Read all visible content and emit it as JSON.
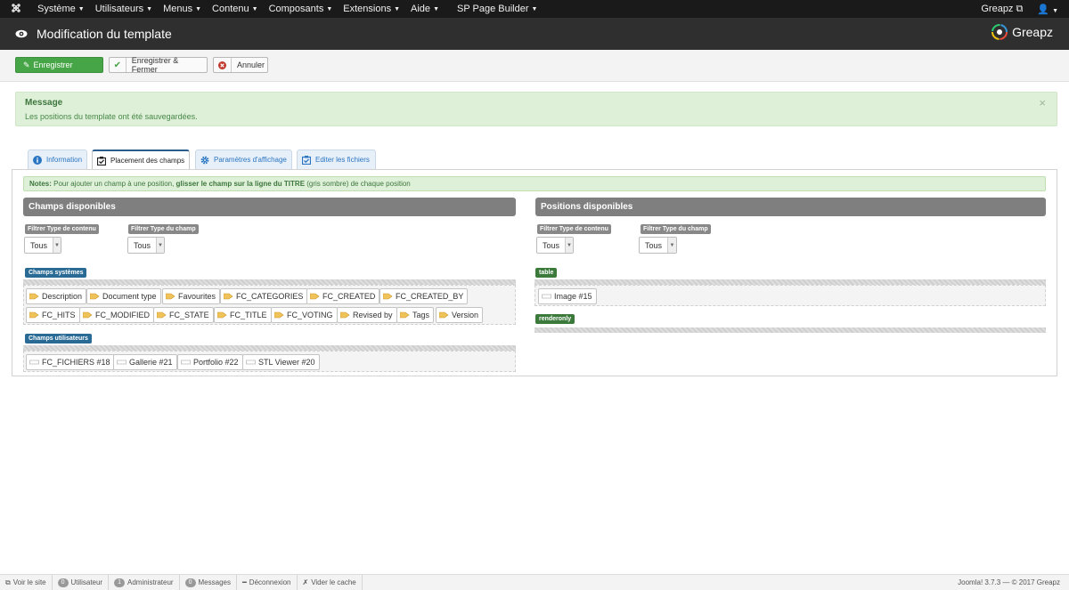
{
  "topnav": {
    "menu": [
      "Système",
      "Utilisateurs",
      "Menus",
      "Contenu",
      "Composants",
      "Extensions",
      "Aide",
      "SP Page Builder"
    ],
    "user_site": "Greapz",
    "user_icon": "user-icon"
  },
  "header": {
    "title": "Modification du template",
    "brand": "Greapz"
  },
  "toolbar": {
    "save": "Enregistrer",
    "save_close": "Enregistrer & Fermer",
    "cancel": "Annuler"
  },
  "message": {
    "title": "Message",
    "text": "Les positions du template ont été sauvegardées.",
    "close": "×"
  },
  "tabs": [
    {
      "label": "Information"
    },
    {
      "label": "Placement des champs"
    },
    {
      "label": "Paramètres d'affichage"
    },
    {
      "label": "Editer les fichiers"
    }
  ],
  "notes": {
    "label": "Notes:",
    "text1": " Pour ajouter un champ à une position, ",
    "bold": "glisser le champ sur la ligne du TITRE",
    "text2": " (gris sombre) de chaque position"
  },
  "left": {
    "header": "Champs disponibles",
    "filter_content_label": "Filtrer Type de contenu",
    "filter_content_value": "Tous",
    "filter_field_label": "Filtrer Type du champ",
    "filter_field_value": "Tous",
    "system_label": "Champs systèmes",
    "system_fields": [
      "Description",
      "Document type",
      "Favourites",
      "FC_CATEGORIES",
      "FC_CREATED",
      "FC_CREATED_BY",
      "FC_HITS",
      "FC_MODIFIED",
      "FC_STATE",
      "FC_TITLE",
      "FC_VOTING",
      "Revised by",
      "Tags",
      "Version"
    ],
    "user_label": "Champs utilisateurs",
    "user_fields": [
      "FC_FICHIERS #18",
      "Gallerie #21",
      "Portfolio #22",
      "STL Viewer #20"
    ]
  },
  "right": {
    "header": "Positions disponibles",
    "filter_content_label": "Filtrer Type de contenu",
    "filter_content_value": "Tous",
    "filter_field_label": "Filtrer Type du champ",
    "filter_field_value": "Tous",
    "pos1_label": "table",
    "pos1_fields": [
      "Image #15"
    ],
    "pos2_label": "renderonly"
  },
  "footer": {
    "view_site": "Voir le site",
    "users_count": "0",
    "users_label": "Utilisateur",
    "admins_count": "1",
    "admins_label": "Administrateur",
    "messages_count": "0",
    "messages_label": "Messages",
    "logout": "Déconnexion",
    "clear_cache": "Vider le cache",
    "copyright": "Joomla! 3.7.3 — © 2017 Greapz"
  },
  "colors": {
    "accent_green": "#46a546",
    "tab_blue": "#2a76c2",
    "dark_header": "#2f2f2f"
  }
}
